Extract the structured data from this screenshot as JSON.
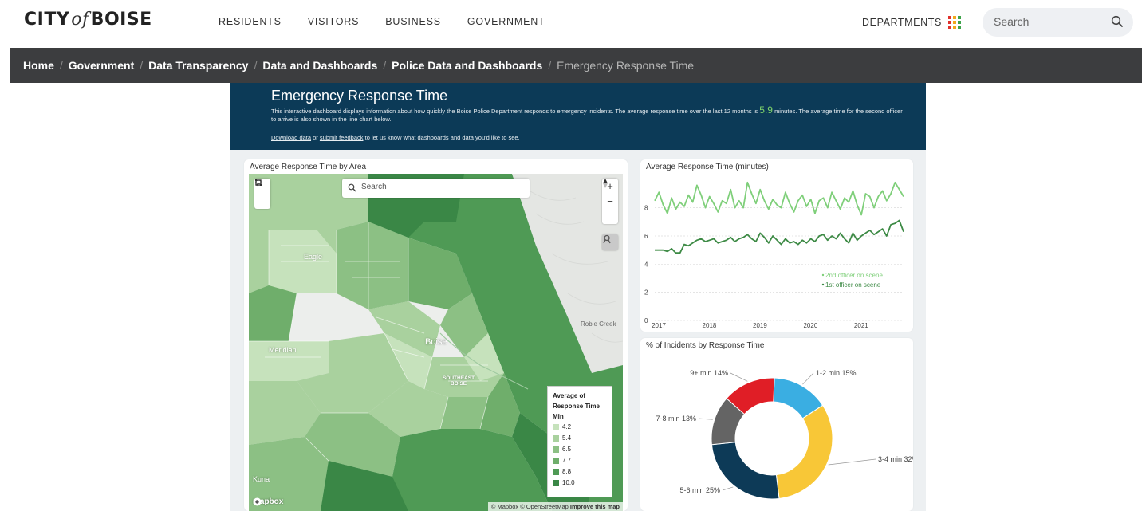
{
  "header": {
    "logo_city": "CITY",
    "logo_of": "of",
    "logo_boise": "BOISE",
    "nav": [
      "RESIDENTS",
      "VISITORS",
      "BUSINESS",
      "GOVERNMENT"
    ],
    "departments_label": "DEPARTMENTS",
    "search_placeholder": "Search",
    "dots_colors": [
      "#e0302b",
      "#f2a81d",
      "#3ea34a",
      "#e0302b",
      "#f2a81d",
      "#3ea34a",
      "#e0302b",
      "#f2a81d",
      "#3ea34a"
    ]
  },
  "breadcrumb": {
    "links": [
      "Home",
      "Government",
      "Data Transparency",
      "Data and Dashboards",
      "Police Data and Dashboards"
    ],
    "current": "Emergency Response Time",
    "separator": "/"
  },
  "banner": {
    "title": "Emergency Response Time",
    "desc_before": "This interactive dashboard displays information about how quickly the Boise Police Department responds to emergency incidents. The average response time over the last 12 months is",
    "avg_value": "5.9",
    "desc_after": "minutes. The average time for the second officer to arrive is also shown in the line chart below.",
    "download_link": "Download data",
    "or_text": "or",
    "feedback_link": "submit feedback",
    "links_after": "to let us know what dashboards and data you'd like to see."
  },
  "map": {
    "title": "Average Response Time by Area",
    "search_placeholder": "Search",
    "zoom_in": "+",
    "zoom_out": "−",
    "places": {
      "eagle": "Eagle",
      "meridian": "Meridian",
      "boise": "Boise",
      "southeast_boise": "SOUTHEAST BOISE",
      "kuna": "Kuna",
      "robie_creek": "Robie Creek"
    },
    "legend_title": "Average of Response Time Min",
    "legend": [
      {
        "label": "4.2",
        "color": "#c6e2bc"
      },
      {
        "label": "5.4",
        "color": "#a9d19e"
      },
      {
        "label": "6.5",
        "color": "#8cc084"
      },
      {
        "label": "7.7",
        "color": "#6fae6b"
      },
      {
        "label": "8.8",
        "color": "#4f9a55"
      },
      {
        "label": "10.0",
        "color": "#3a8746"
      }
    ],
    "mapbox_label": "mapbox",
    "attribution": "© Mapbox © OpenStreetMap",
    "improve": "Improve this map"
  },
  "line_chart": {
    "title": "Average Response Time (minutes)",
    "legend_items": [
      "2nd officer on scene",
      "1st officer on scene"
    ]
  },
  "donut_chart": {
    "title": "% of Incidents by Response Time"
  },
  "chart_data": [
    {
      "type": "line",
      "title": "Average Response Time (minutes)",
      "x_ticks": [
        "2017",
        "2018",
        "2019",
        "2020",
        "2021"
      ],
      "y_ticks": [
        0,
        2,
        4,
        6,
        8
      ],
      "ylim": [
        0,
        10.3
      ],
      "xlim": [
        "2017-01",
        "2021-12"
      ],
      "grid": true,
      "legend": "right",
      "series": [
        {
          "name": "2nd officer on scene",
          "color": "#7fcf7a",
          "x": [
            "2017-01",
            "2017-02",
            "2017-03",
            "2017-04",
            "2017-05",
            "2017-06",
            "2017-07",
            "2017-08",
            "2017-09",
            "2017-10",
            "2017-11",
            "2017-12",
            "2018-01",
            "2018-02",
            "2018-03",
            "2018-04",
            "2018-05",
            "2018-06",
            "2018-07",
            "2018-08",
            "2018-09",
            "2018-10",
            "2018-11",
            "2018-12",
            "2019-01",
            "2019-02",
            "2019-03",
            "2019-04",
            "2019-05",
            "2019-06",
            "2019-07",
            "2019-08",
            "2019-09",
            "2019-10",
            "2019-11",
            "2019-12",
            "2020-01",
            "2020-02",
            "2020-03",
            "2020-04",
            "2020-05",
            "2020-06",
            "2020-07",
            "2020-08",
            "2020-09",
            "2020-10",
            "2020-11",
            "2020-12",
            "2021-01",
            "2021-02",
            "2021-03",
            "2021-04",
            "2021-05",
            "2021-06",
            "2021-07",
            "2021-08",
            "2021-09",
            "2021-10",
            "2021-11",
            "2021-12"
          ],
          "values": [
            8.5,
            9.1,
            8.2,
            7.6,
            8.7,
            7.9,
            8.4,
            8.1,
            8.9,
            8.4,
            9.6,
            8.9,
            8.0,
            8.8,
            8.3,
            7.7,
            8.5,
            8.3,
            9.3,
            8.0,
            8.5,
            8.0,
            9.8,
            9.0,
            8.3,
            9.3,
            8.5,
            7.9,
            8.6,
            8.2,
            8.0,
            9.1,
            8.3,
            7.7,
            8.5,
            8.9,
            8.1,
            8.6,
            7.6,
            8.5,
            8.7,
            8.0,
            9.1,
            8.5,
            7.9,
            8.7,
            8.4,
            9.2,
            8.2,
            7.5,
            9.0,
            8.8,
            8.0,
            8.8,
            9.2,
            8.5,
            9.0,
            9.8,
            9.3,
            8.8
          ]
        },
        {
          "name": "1st officer on scene",
          "color": "#3d8a45",
          "x": [
            "2017-01",
            "2017-02",
            "2017-03",
            "2017-04",
            "2017-05",
            "2017-06",
            "2017-07",
            "2017-08",
            "2017-09",
            "2017-10",
            "2017-11",
            "2017-12",
            "2018-01",
            "2018-02",
            "2018-03",
            "2018-04",
            "2018-05",
            "2018-06",
            "2018-07",
            "2018-08",
            "2018-09",
            "2018-10",
            "2018-11",
            "2018-12",
            "2019-01",
            "2019-02",
            "2019-03",
            "2019-04",
            "2019-05",
            "2019-06",
            "2019-07",
            "2019-08",
            "2019-09",
            "2019-10",
            "2019-11",
            "2019-12",
            "2020-01",
            "2020-02",
            "2020-03",
            "2020-04",
            "2020-05",
            "2020-06",
            "2020-07",
            "2020-08",
            "2020-09",
            "2020-10",
            "2020-11",
            "2020-12",
            "2021-01",
            "2021-02",
            "2021-03",
            "2021-04",
            "2021-05",
            "2021-06",
            "2021-07",
            "2021-08",
            "2021-09",
            "2021-10",
            "2021-11",
            "2021-12"
          ],
          "values": [
            5.0,
            5.0,
            5.0,
            4.9,
            5.1,
            4.8,
            4.8,
            5.4,
            5.3,
            5.5,
            5.7,
            5.8,
            5.6,
            5.7,
            5.8,
            5.5,
            5.6,
            5.7,
            5.9,
            5.6,
            5.8,
            5.9,
            6.1,
            5.8,
            5.6,
            6.2,
            5.9,
            5.5,
            6.0,
            5.7,
            5.4,
            5.8,
            5.5,
            5.6,
            5.4,
            5.7,
            5.5,
            5.8,
            5.6,
            6.0,
            6.1,
            5.7,
            6.0,
            5.8,
            6.2,
            5.8,
            5.5,
            6.2,
            5.7,
            6.0,
            6.2,
            6.4,
            6.1,
            6.3,
            6.5,
            6.0,
            6.8,
            6.9,
            7.1,
            6.3
          ]
        }
      ]
    },
    {
      "type": "pie",
      "title": "% of Incidents by Response Time",
      "donut": true,
      "categories": [
        "1-2 min",
        "3-4 min",
        "5-6 min",
        "7-8 min",
        "9+ min"
      ],
      "values": [
        15,
        32,
        25,
        13,
        14
      ],
      "colors": [
        "#3aaee2",
        "#f8c737",
        "#0d3a57",
        "#646464",
        "#e01e26"
      ],
      "labels": [
        "1-2 min 15%",
        "3-4 min 32%",
        "5-6 min 25%",
        "7-8 min 13%",
        "9+ min 14%"
      ]
    }
  ]
}
